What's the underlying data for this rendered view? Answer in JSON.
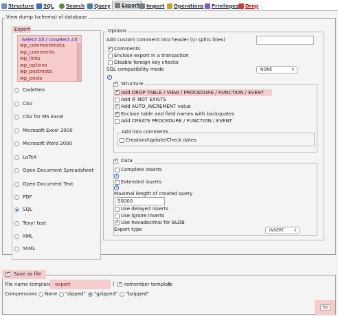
{
  "tabs": [
    {
      "label": "Structure",
      "icon": "table-structure-icon",
      "color": "#6a8fc5"
    },
    {
      "label": "SQL",
      "icon": "sql-icon",
      "color": "#3a6bc7"
    },
    {
      "label": "Search",
      "icon": "search-icon",
      "color": "#5a8a3a"
    },
    {
      "label": "Query",
      "icon": "query-icon",
      "color": "#4a7ab5"
    },
    {
      "label": "Export",
      "icon": "export-icon",
      "color": "#7a7a7a"
    },
    {
      "label": "Import",
      "icon": "import-icon",
      "color": "#7a7a7a"
    },
    {
      "label": "Operations",
      "icon": "operations-icon",
      "color": "#c8a03a"
    },
    {
      "label": "Privileges",
      "icon": "privileges-icon",
      "color": "#8a5ab5"
    },
    {
      "label": "Drop",
      "icon": "drop-icon",
      "color": "#d33"
    }
  ],
  "main": {
    "title": "View dump (schema) of database",
    "export": {
      "legend": "Export",
      "select_all": "Select All / Unselect All",
      "tables": [
        "wp_commentmeta",
        "wp_comments",
        "wp_links",
        "wp_options",
        "wp_postmeta",
        "wp_posts"
      ],
      "formats": [
        "CodeGen",
        "CSV",
        "CSV for MS Excel",
        "Microsoft Excel 2000",
        "Microsoft Word 2000",
        "LaTeX",
        "Open Document Spreadsheet",
        "Open Document Text",
        "PDF",
        "SQL",
        "Texy! text",
        "XML",
        "YAML"
      ],
      "selected_format": "SQL"
    },
    "options": {
      "legend": "Options",
      "custom_comment_label": "Add custom comment into header (\\n splits lines)",
      "comments": "Comments",
      "enclose_transaction": "Enclose export in a transaction",
      "disable_fk": "Disable foreign key checks",
      "compat_label": "SQL compatibility mode",
      "compat_value": "NONE",
      "structure": {
        "legend": "Structure",
        "add_drop": "Add DROP TABLE / VIEW / PROCEDURE / FUNCTION / EVENT",
        "if_not_exists": "Add IF NOT EXISTS",
        "auto_increment": "Add AUTO_INCREMENT value",
        "backquotes": "Enclose table and field names with backquotes",
        "create_proc": "Add CREATE PROCEDURE / FUNCTION / EVENT",
        "comments_legend": "Add into comments",
        "creation_dates": "Creation/Update/Check dates"
      },
      "data": {
        "legend": "Data",
        "complete_inserts": "Complete inserts",
        "extended_inserts": "Extended inserts",
        "max_length_label": "Maximal length of created query",
        "max_length_value": "50000",
        "delayed_inserts": "Use delayed inserts",
        "ignore_inserts": "Use ignore inserts",
        "hex_blob": "Use hexadecimal for BLOB",
        "export_type_label": "Export type",
        "export_type_value": "INSERT"
      }
    }
  },
  "save": {
    "legend": "Save as file",
    "filename_label": "File name template",
    "filename_value": "export",
    "paren_open": "(",
    "remember": "remember template",
    "paren_close": ")",
    "compression_label": "Compression:",
    "compression_options": [
      "None",
      "\"zipped\"",
      "\"gzipped\"",
      "\"bzipped\""
    ],
    "go": "Go"
  },
  "colors": {
    "highlight": "#f6cccc",
    "link": "#1a2fd8",
    "drop": "#cc0000"
  }
}
